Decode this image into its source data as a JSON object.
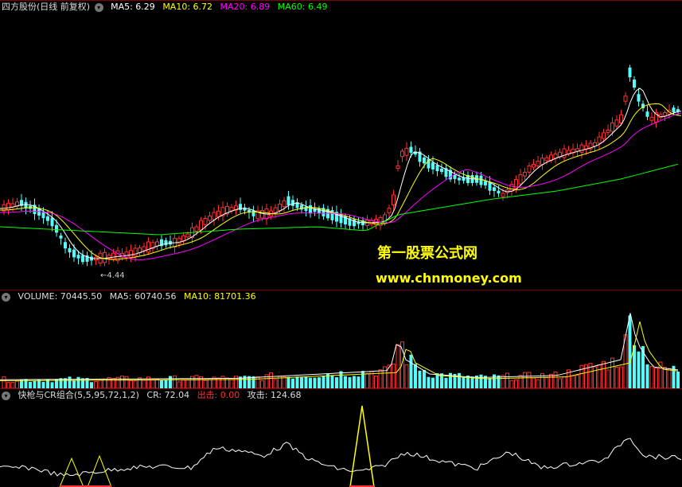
{
  "price_panel": {
    "title": "四方股份(日线 前复权)",
    "indicators": [
      {
        "label": "MA5: 6.29",
        "color": "#ffffff"
      },
      {
        "label": "MA10: 6.72",
        "color": "#ffff00"
      },
      {
        "label": "MA20: 6.89",
        "color": "#ff00ff"
      },
      {
        "label": "MA60: 6.49",
        "color": "#00ff00"
      }
    ],
    "low_label": "←4.44",
    "watermark_title": "第一股票公式网",
    "watermark_url": "www.chnmoney.com"
  },
  "volume_panel": {
    "indicators": [
      {
        "label": "VOLUME: 70445.50",
        "color": "#dddddd"
      },
      {
        "label": "MA5: 60740.56",
        "color": "#dddddd"
      },
      {
        "label": "MA10: 81701.36",
        "color": "#ffff00"
      }
    ]
  },
  "cr_panel": {
    "indicators": [
      {
        "label": "快枪与CR组合(5,5,95,72,1,2)",
        "color": "#dddddd"
      },
      {
        "label": "CR: 72.04",
        "color": "#dddddd"
      },
      {
        "label": "出击: 0.00",
        "color": "#ff3030"
      },
      {
        "label": "攻击: 124.68",
        "color": "#dddddd"
      }
    ]
  },
  "colors": {
    "up": "#ff3030",
    "down": "#54fcfc",
    "ma5": "#ffffff",
    "ma10": "#ffff00",
    "ma20": "#ff00ff",
    "ma60": "#00ff00",
    "separator": "#7a0000"
  },
  "icons": {
    "dropdown": "chevron-down-icon"
  }
}
